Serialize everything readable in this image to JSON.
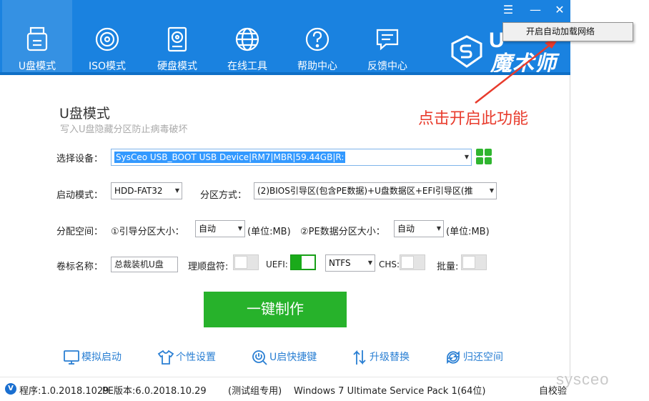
{
  "nav": [
    {
      "label": "U盘模式",
      "icon": "usb-drive-icon"
    },
    {
      "label": "ISO模式",
      "icon": "disc-icon"
    },
    {
      "label": "硬盘模式",
      "icon": "hard-disk-icon"
    },
    {
      "label": "在线工具",
      "icon": "globe-icon"
    },
    {
      "label": "帮助中心",
      "icon": "help-icon"
    },
    {
      "label": "反馈中心",
      "icon": "feedback-icon"
    }
  ],
  "window_controls": {
    "menu": "☰",
    "minimize": "—",
    "close": "✕"
  },
  "brand": {
    "u": "U",
    "name": "魔术师"
  },
  "context_menu": {
    "item": "开启自动加载网络"
  },
  "page": {
    "title": "U盘模式",
    "subtitle": "写入U盘隐藏分区防止病毒破坏"
  },
  "annotation": "点击开启此功能",
  "form": {
    "device_label": "选择设备：",
    "device_value": "SysCeo USB_BOOT USB Device|RM7|MBR|59.44GB|R:",
    "boot_mode_label": "启动模式：",
    "boot_mode_value": "HDD-FAT32",
    "partition_label": "分区方式：",
    "partition_value": "(2)BIOS引导区(包含PE数据)+U盘数据区+EFI引导区(推",
    "alloc_label": "分配空间：",
    "boot_size_label": "①引导分区大小：",
    "boot_size_value": "自动",
    "unit1": "(单位:MB)",
    "pe_size_label": "②PE数据分区大小：",
    "pe_size_value": "自动",
    "unit2": "(单位:MB)",
    "volume_label": "卷标名称：",
    "volume_value": "总裁装机U盘",
    "drive_letter_label": "理顺盘符:",
    "uefi_label": "UEFI:",
    "fs_value": "NTFS",
    "chs_label": "CHS:",
    "batch_label": "批量:"
  },
  "toggles": {
    "drive_letter": false,
    "uefi": true,
    "chs": false,
    "batch": false
  },
  "make_button": "一键制作",
  "tools": [
    {
      "label": "模拟启动",
      "icon": "monitor-icon"
    },
    {
      "label": "个性设置",
      "icon": "shirt-icon"
    },
    {
      "label": "U启快捷键",
      "icon": "power-search-icon"
    },
    {
      "label": "升级替换",
      "icon": "upgrade-arrows-icon"
    },
    {
      "label": "归还空间",
      "icon": "refresh-icon"
    }
  ],
  "status": {
    "v_badge": "V",
    "program": "程序:1.0.2018.1029",
    "pe": "PE版本:6.0.2018.10.29",
    "group": "(测试组专用)",
    "os": "Windows 7 Ultimate Service Pack 1(64位)",
    "check": "自校验"
  },
  "watermark": "sysceo",
  "colors": {
    "header": "#1a82e0",
    "accent_green": "#27b22b",
    "annotation_red": "#e83b2c",
    "link_blue": "#2a7fd3"
  }
}
